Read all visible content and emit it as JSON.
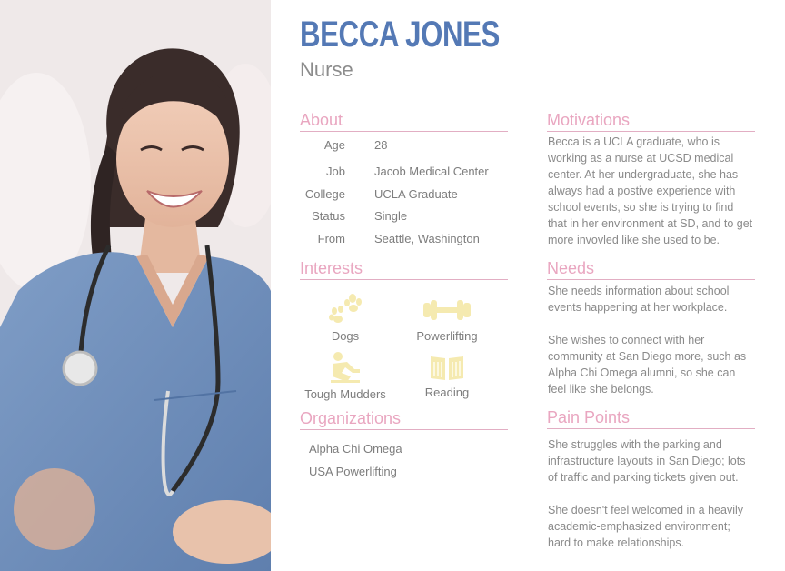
{
  "persona": {
    "name": "Becca Jones",
    "role": "Nurse"
  },
  "about": {
    "heading": "About",
    "rows": [
      {
        "label": "Age",
        "value": "28"
      },
      {
        "label": "Job",
        "value": "Jacob Medical Center"
      },
      {
        "label": "College",
        "value": "UCLA Graduate"
      },
      {
        "label": "Status",
        "value": "Single"
      },
      {
        "label": "From",
        "value": "Seattle, Washington"
      }
    ]
  },
  "interests": {
    "heading": "Interests",
    "items": [
      {
        "label": "Dogs",
        "icon": "paw-icon"
      },
      {
        "label": "Powerlifting",
        "icon": "dumbbell-icon"
      },
      {
        "label": "Tough Mudders",
        "icon": "runner-icon"
      },
      {
        "label": "Reading",
        "icon": "book-icon"
      }
    ],
    "icon_color": "#f5eab0"
  },
  "organizations": {
    "heading": "Organizations",
    "items": [
      "Alpha Chi Omega",
      "USA Powerlifting"
    ]
  },
  "motivations": {
    "heading": "Motivations",
    "text": "Becca is a UCLA graduate, who is working as a nurse at UCSD medical center. At her undergraduate, she has always had a postive experience with school events, so she is trying to find that in her environment at SD, and to get more invovled like she used to be."
  },
  "needs": {
    "heading": "Needs",
    "paragraphs": [
      "She needs information about school events happening at her workplace.",
      "She wishes to connect with her community at San Diego more, such as Alpha Chi Omega alumni, so she can feel like she belongs."
    ]
  },
  "pain_points": {
    "heading": "Pain Points",
    "paragraphs": [
      "She struggles with the parking and infrastructure layouts in San Diego; lots of traffic and parking tickets given out.",
      "She doesn't feel welcomed in a heavily academic-emphasized environment; hard to make relationships."
    ]
  },
  "colors": {
    "name": "#5479b5",
    "heading": "#e9a6c0",
    "rule": "#e2aec3",
    "body_text": "#8a8a8a"
  }
}
